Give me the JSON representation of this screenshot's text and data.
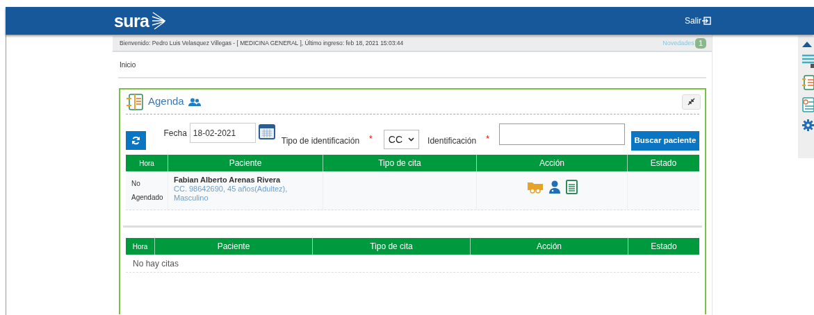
{
  "header": {
    "logo": "sura",
    "logout": "Salir"
  },
  "welcome": {
    "text": "Bienvenido: Pedro Luis Velasquez Villegas - [ MEDICINA GENERAL ], Último ingreso: feb 18, 2021 15:03:44",
    "news_label": "Novedades",
    "news_count": "1"
  },
  "breadcrumb": "Inicio",
  "agenda": {
    "title": "Agenda",
    "search": {
      "date_label": "Fecha",
      "date_value": "18-02-2021",
      "id_type_label": "Tipo de identificación",
      "required_mark": "*",
      "id_type_value": "CC",
      "id_label": "Identificación",
      "id_required_mark": "*",
      "button": "Buscar paciente"
    },
    "tables": [
      {
        "columns": [
          "Hora",
          "Paciente",
          "Tipo de cita",
          "Acción",
          "Estado"
        ],
        "rows": [
          {
            "hora": "No Agendado",
            "patient_name": "Fabian Alberto Arenas Rivera",
            "patient_details": "CC. 98642690, 45 años(Adultez), Masculino"
          }
        ]
      },
      {
        "columns": [
          "Hora",
          "Paciente",
          "Tipo de cita",
          "Acción",
          "Estado"
        ],
        "empty_text": "No hay citas"
      }
    ]
  }
}
